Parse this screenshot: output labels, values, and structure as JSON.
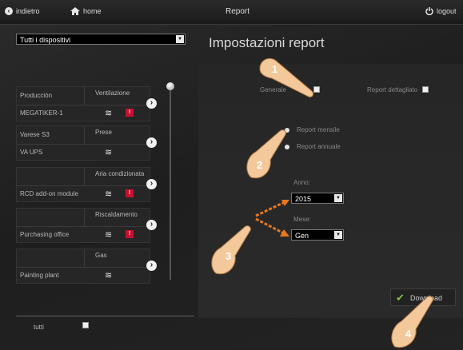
{
  "topbar": {
    "back_label": "indietro",
    "home_label": "home",
    "title": "Report",
    "logout_label": "logout"
  },
  "device_filter": {
    "selected": "Tutti i dispositivi"
  },
  "report_heading": "Impostazioni report",
  "devices": [
    {
      "location": "Producción",
      "category": "Ventilazione",
      "name": "MEGATIKER-1",
      "alert": true
    },
    {
      "location": "Varese S3",
      "category": "Prese",
      "name": "VA UPS",
      "alert": false
    },
    {
      "location": "",
      "category": "Aria condizionata",
      "name": "RCD add-on module",
      "alert": true
    },
    {
      "location": "",
      "category": "Riscaldamento",
      "name": "Purchasing office",
      "alert": true
    },
    {
      "location": "",
      "category": "Gas",
      "name": "Painting plant",
      "alert": false
    }
  ],
  "select_all_label": "tutti",
  "options": {
    "general_label": "Generale",
    "detailed_label": "Report dettagliato",
    "monthly_label": "Report mensile",
    "annual_label": "Report annuale",
    "year_label": "Anno:",
    "year_value": "2015",
    "month_label": "Mese:",
    "month_value": "Gen",
    "download_label": "Download"
  },
  "callouts": [
    "1",
    "2",
    "3",
    "4"
  ],
  "colors": {
    "accent_arrow": "#e8771e",
    "alert": "#c8102e",
    "download_check": "#7ec242"
  },
  "icons": [
    "back-circle-icon",
    "home-icon",
    "power-icon",
    "wifi-icon",
    "alert-icon",
    "chevron-right-icon",
    "check-icon",
    "hand-pointer-icon"
  ]
}
